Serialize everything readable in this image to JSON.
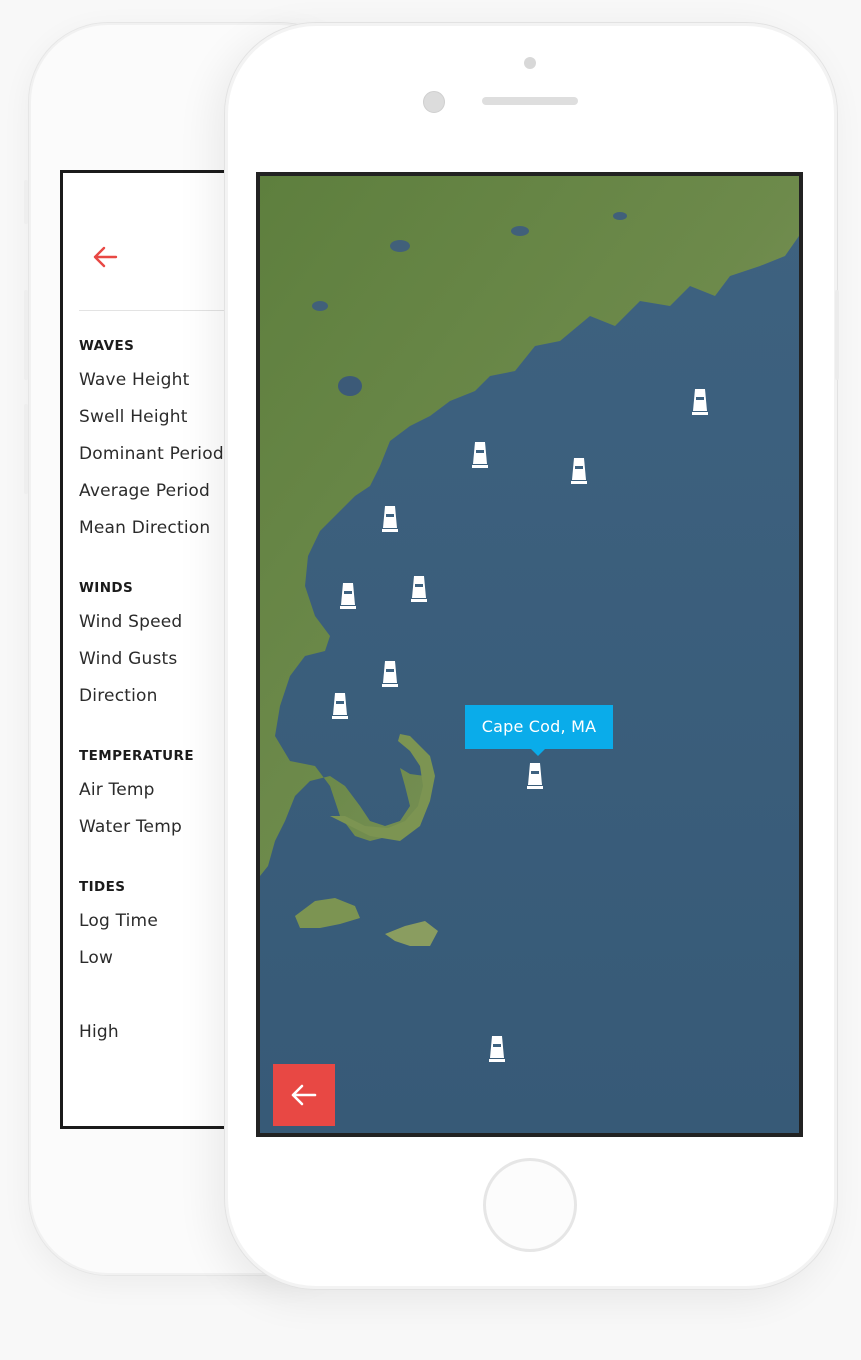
{
  "menu": {
    "sections": [
      {
        "heading": "WAVES",
        "items": [
          "Wave Height",
          "Swell Height",
          "Dominant Period",
          "Average Period",
          "Mean Direction"
        ]
      },
      {
        "heading": "WINDS",
        "items": [
          "Wind Speed",
          "Wind Gusts",
          "Direction"
        ]
      },
      {
        "heading": "TEMPERATURE",
        "items": [
          "Air Temp",
          "Water Temp"
        ]
      },
      {
        "heading": "TIDES",
        "items": [
          "Log Time",
          "Low",
          "",
          "High"
        ]
      }
    ]
  },
  "map": {
    "popup_label": "Cape Cod, MA"
  },
  "colors": {
    "accent": "#e84844",
    "popup": "#0aacea",
    "ocean": "#3c5f7b",
    "land": "#6b8a4a"
  }
}
